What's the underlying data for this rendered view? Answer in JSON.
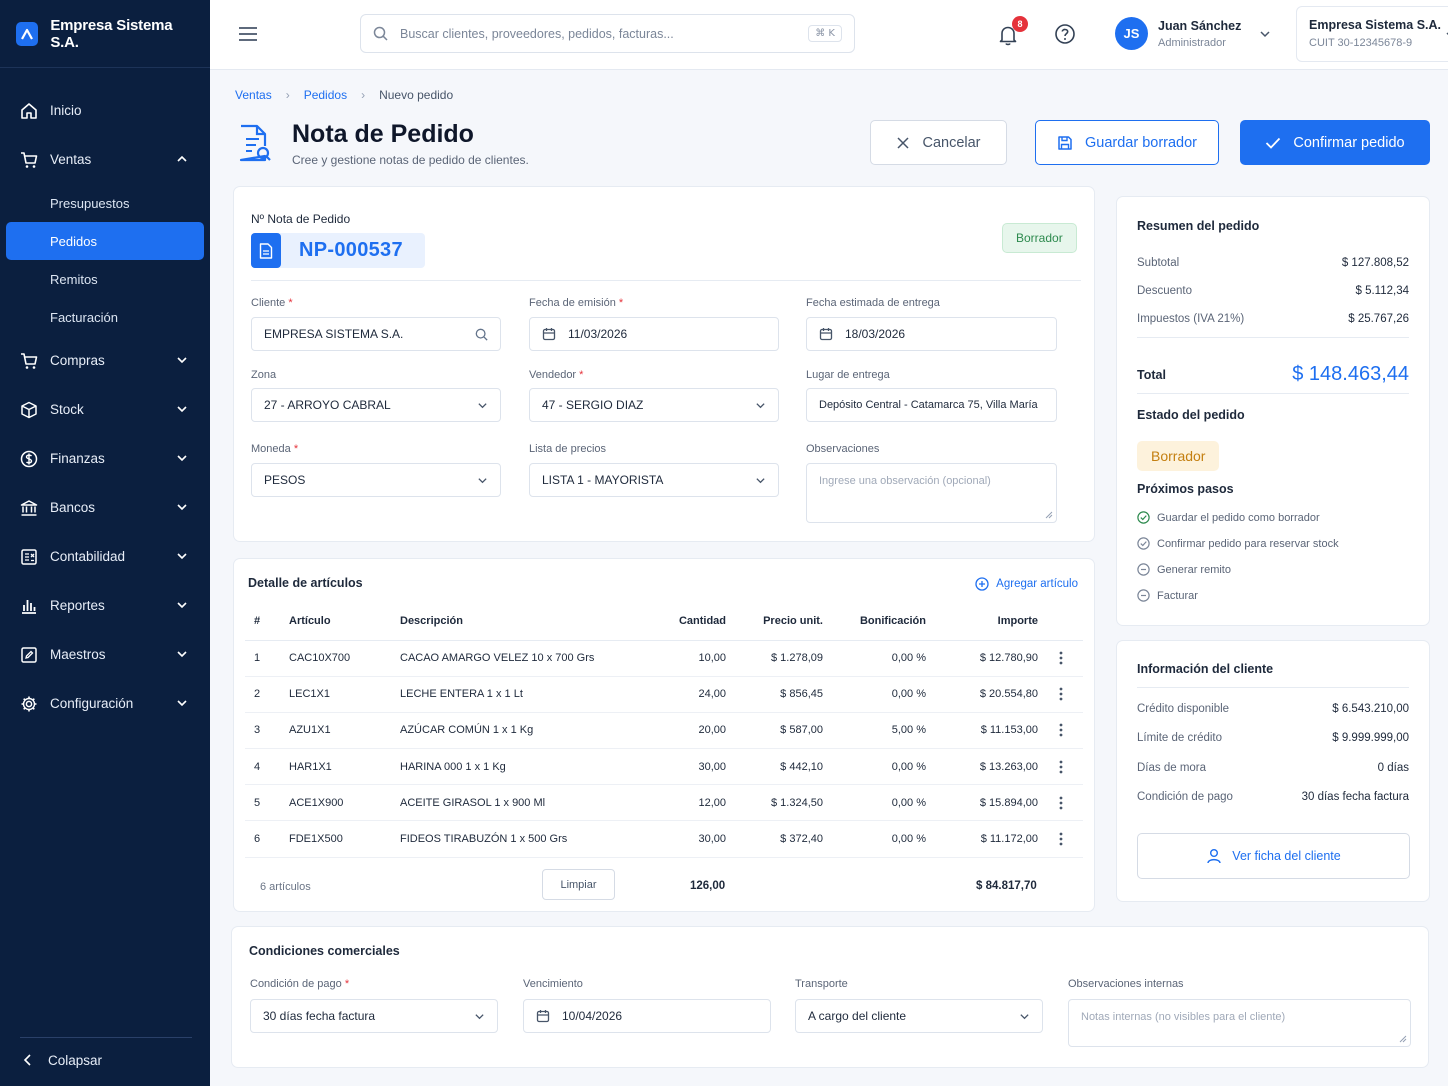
{
  "app": {
    "company_name": "Empresa Sistema S.A."
  },
  "sidebar": {
    "items": [
      {
        "label": "Inicio",
        "icon": "home-icon"
      },
      {
        "label": "Ventas",
        "icon": "cart-icon",
        "expanded": true
      },
      {
        "label": "Compras",
        "icon": "cart-icon"
      },
      {
        "label": "Stock",
        "icon": "box-icon"
      },
      {
        "label": "Finanzas",
        "icon": "dollar-icon"
      },
      {
        "label": "Bancos",
        "icon": "bank-icon"
      },
      {
        "label": "Contabilidad",
        "icon": "ledger-icon"
      },
      {
        "label": "Reportes",
        "icon": "bar-chart-icon"
      },
      {
        "label": "Maestros",
        "icon": "edit-icon"
      },
      {
        "label": "Configuración",
        "icon": "gear-icon"
      }
    ],
    "sub_items": [
      "Presupuestos",
      "Pedidos",
      "Remitos",
      "Facturación"
    ],
    "active_sub": "Pedidos",
    "collapse_label": "Colapsar"
  },
  "topbar": {
    "search_placeholder": "Buscar clientes, proveedores, pedidos, facturas...",
    "shortcut": "⌘ K",
    "notifications": "8",
    "user": {
      "initials": "JS",
      "name": "Juan Sánchez",
      "role": "Administrador"
    },
    "company": {
      "name": "Empresa Sistema S.A.",
      "cuit": "CUIT 30-12345678-9"
    }
  },
  "breadcrumb": [
    "Ventas",
    "Pedidos",
    "Nuevo pedido"
  ],
  "page": {
    "title": "Nota de Pedido",
    "subtitle": "Cree y gestione notas de pedido de clientes."
  },
  "actions": {
    "cancel": "Cancelar",
    "save_draft": "Guardar borrador",
    "confirm": "Confirmar pedido"
  },
  "order": {
    "number_label": "Nº Nota de Pedido",
    "number": "NP-000537",
    "status": "Borrador",
    "fields": {
      "cliente": {
        "label": "Cliente",
        "value": "EMPRESA SISTEMA S.A."
      },
      "fecha_emision": {
        "label": "Fecha de emisión",
        "value": "11/03/2026"
      },
      "fecha_entrega": {
        "label": "Fecha estimada de entrega",
        "value": "18/03/2026"
      },
      "zona": {
        "label": "Zona",
        "value": "27 - ARROYO CABRAL"
      },
      "vendedor": {
        "label": "Vendedor",
        "value": "47 - SERGIO DIAZ"
      },
      "lugar": {
        "label": "Lugar de entrega",
        "value": "Depósito Central - Catamarca 75, Villa María"
      },
      "moneda": {
        "label": "Moneda",
        "value": "PESOS"
      },
      "lista": {
        "label": "Lista de precios",
        "value": "LISTA 1 - MAYORISTA"
      },
      "observaciones": {
        "label": "Observaciones",
        "placeholder": "Ingrese una observación (opcional)"
      }
    }
  },
  "items": {
    "title": "Detalle de artículos",
    "add_label": "Agregar artículo",
    "columns": [
      "#",
      "Artículo",
      "Descripción",
      "Cantidad",
      "Precio unit.",
      "Bonificación",
      "Importe"
    ],
    "rows": [
      {
        "n": "1",
        "code": "CAC10X700",
        "desc": "CACAO AMARGO VELEZ 10 x 700 Grs",
        "qty": "10,00",
        "price": "$ 1.278,09",
        "disc": "0,00 %",
        "amount": "$ 12.780,90"
      },
      {
        "n": "2",
        "code": "LEC1X1",
        "desc": "LECHE ENTERA 1 x 1 Lt",
        "qty": "24,00",
        "price": "$ 856,45",
        "disc": "0,00 %",
        "amount": "$ 20.554,80"
      },
      {
        "n": "3",
        "code": "AZU1X1",
        "desc": "AZÚCAR COMÚN 1 x 1 Kg",
        "qty": "20,00",
        "price": "$ 587,00",
        "disc": "5,00 %",
        "amount": "$ 11.153,00"
      },
      {
        "n": "4",
        "code": "HAR1X1",
        "desc": "HARINA 000 1 x 1 Kg",
        "qty": "30,00",
        "price": "$ 442,10",
        "disc": "0,00 %",
        "amount": "$ 13.263,00"
      },
      {
        "n": "5",
        "code": "ACE1X900",
        "desc": "ACEITE GIRASOL 1 x 900 Ml",
        "qty": "12,00",
        "price": "$ 1.324,50",
        "disc": "0,00 %",
        "amount": "$ 15.894,00"
      },
      {
        "n": "6",
        "code": "FDE1X500",
        "desc": "FIDEOS TIRABUZÓN 1 x 500 Grs",
        "qty": "30,00",
        "price": "$ 372,40",
        "disc": "0,00 %",
        "amount": "$ 11.172,00"
      }
    ],
    "footer": {
      "count": "6 artículos",
      "clear": "Limpiar",
      "total_qty": "126,00",
      "total_amount": "$ 84.817,70"
    }
  },
  "summary": {
    "title": "Resumen del pedido",
    "subtotal": {
      "label": "Subtotal",
      "value": "$ 127.808,52"
    },
    "descuento": {
      "label": "Descuento",
      "value": "$ 5.112,34"
    },
    "impuestos": {
      "label": "Impuestos (IVA 21%)",
      "value": "$ 25.767,26"
    },
    "total": {
      "label": "Total",
      "value": "$ 148.463,44"
    },
    "state_title": "Estado del pedido",
    "state": "Borrador",
    "next_title": "Próximos pasos",
    "steps": [
      {
        "label": "Guardar el pedido como borrador",
        "done": true
      },
      {
        "label": "Confirmar pedido para reservar stock",
        "done": false
      },
      {
        "label": "Generar remito",
        "done": false
      },
      {
        "label": "Facturar",
        "done": false
      }
    ]
  },
  "client_info": {
    "title": "Información del cliente",
    "rows": [
      {
        "label": "Crédito disponible",
        "value": "$ 6.543.210,00"
      },
      {
        "label": "Límite de crédito",
        "value": "$ 9.999.999,00"
      },
      {
        "label": "Días de mora",
        "value": "0 días"
      },
      {
        "label": "Condición de pago",
        "value": "30 días fecha factura"
      }
    ],
    "button": "Ver ficha del cliente"
  },
  "conditions": {
    "title": "Condiciones comerciales",
    "pago": {
      "label": "Condición de pago",
      "value": "30 días fecha factura"
    },
    "vencimiento": {
      "label": "Vencimiento",
      "value": "10/04/2026"
    },
    "transporte": {
      "label": "Transporte",
      "value": "A cargo del cliente"
    },
    "obs_internas": {
      "label": "Observaciones internas",
      "placeholder": "Notas internas (no visibles para el cliente)"
    }
  },
  "colors": {
    "primary": "#1e6ff0",
    "sidebar": "#0b1f3f",
    "draft": "#c47f10",
    "success": "#2d8a4e",
    "danger": "#e5323b"
  }
}
